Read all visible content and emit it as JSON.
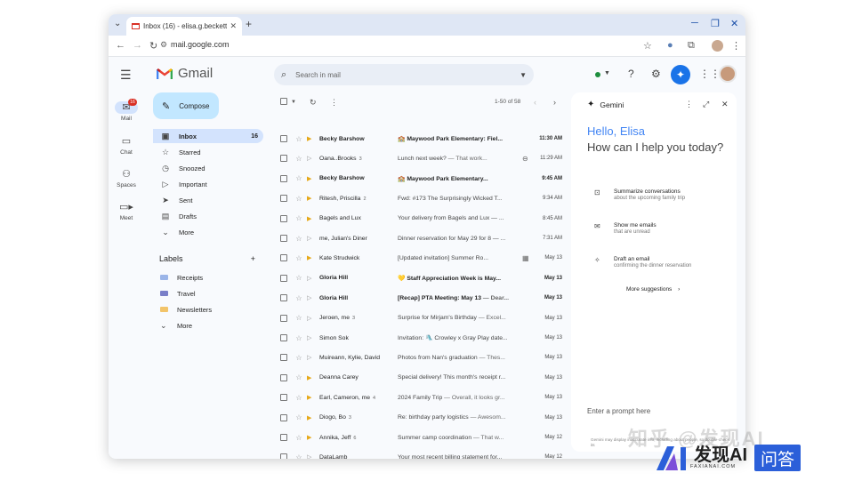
{
  "browser": {
    "tab_title": "Inbox (16) - elisa.g.beckett@",
    "url": "mail.google.com"
  },
  "gmail": {
    "product_name": "Gmail",
    "search_placeholder": "Search in mail",
    "pagination": "1-50 of 58"
  },
  "rail": {
    "items": [
      {
        "label": "Mail",
        "icon": "mail-icon",
        "badge": "16"
      },
      {
        "label": "Chat",
        "icon": "chat-icon"
      },
      {
        "label": "Spaces",
        "icon": "spaces-icon"
      },
      {
        "label": "Meet",
        "icon": "meet-icon"
      }
    ]
  },
  "sidebar": {
    "compose_label": "Compose",
    "nav": [
      {
        "label": "Inbox",
        "count": "16",
        "icon": "inbox-icon"
      },
      {
        "label": "Starred",
        "icon": "star-icon"
      },
      {
        "label": "Snoozed",
        "icon": "clock-icon"
      },
      {
        "label": "Important",
        "icon": "important-icon"
      },
      {
        "label": "Sent",
        "icon": "send-icon"
      },
      {
        "label": "Drafts",
        "icon": "draft-icon"
      },
      {
        "label": "More",
        "icon": "chevron-down-icon"
      }
    ],
    "labels_heading": "Labels",
    "labels": [
      {
        "label": "Receipts",
        "color": "#9bb5e8"
      },
      {
        "label": "Travel",
        "color": "#7a7fc8"
      },
      {
        "label": "Newsletters",
        "color": "#f2c46a"
      },
      {
        "label": "More"
      }
    ]
  },
  "emails": [
    {
      "sender": "Becky Barshow",
      "subject": "🏫 Maywood Park Elementary: Fiel...",
      "snippet": "",
      "date": "11:30 AM",
      "unread": true,
      "important": true
    },
    {
      "sender": "Oana..Brooks",
      "count": "3",
      "subject": "Lunch next week?",
      "snippet": " — That work...",
      "date": "11:29 AM",
      "unread": false,
      "important": false,
      "attachment": true
    },
    {
      "sender": "Becky Barshow",
      "subject": "🏫 Maywood Park Elementary...",
      "snippet": "",
      "date": "9:45 AM",
      "unread": true,
      "important": true
    },
    {
      "sender": "Ritesh, Priscilla",
      "count": "2",
      "subject": "Fwd: #173 The Surprisingly Wicked T...",
      "snippet": "",
      "date": "9:34 AM",
      "unread": false,
      "important": true
    },
    {
      "sender": "Bagels and Lux",
      "subject": "Your delivery from Bagels and Lux — ...",
      "snippet": "",
      "date": "8:45 AM",
      "unread": false,
      "important": true
    },
    {
      "sender": "me, Julian's Diner",
      "subject": "Dinner reservation for May 29 for 8 — ...",
      "snippet": "",
      "date": "7:31 AM",
      "unread": false,
      "important": false
    },
    {
      "sender": "Kate Strudwick",
      "subject": "[Updated invitation] Summer Ro...",
      "snippet": "",
      "date": "May 13",
      "unread": false,
      "important": true,
      "calendar": true
    },
    {
      "sender": "Gloria Hill",
      "subject": "💛 Staff Appreciation Week is May...",
      "snippet": "",
      "date": "May 13",
      "unread": true,
      "important": false
    },
    {
      "sender": "Gloria Hill",
      "subject": "[Recap] PTA Meeting: May 13",
      "snippet": " — Dear...",
      "date": "May 13",
      "unread": true,
      "important": false
    },
    {
      "sender": "Jeroen, me",
      "count": "3",
      "subject": "Surprise for Mirjam's Birthday",
      "snippet": " — Excel...",
      "date": "May 13",
      "unread": false,
      "important": false
    },
    {
      "sender": "Simon Sok",
      "subject": "Invitation: 🛝 Crowley x Gray Play date...",
      "snippet": "",
      "date": "May 13",
      "unread": false,
      "important": false
    },
    {
      "sender": "Muireann, Kylie, David",
      "subject": "Photos from Nan's graduation",
      "snippet": " — Thes...",
      "date": "May 13",
      "unread": false,
      "important": false
    },
    {
      "sender": "Deanna Carey",
      "subject": "Special delivery! This month's receipt r...",
      "snippet": "",
      "date": "May 13",
      "unread": false,
      "important": true
    },
    {
      "sender": "Earl, Cameron, me",
      "count": "4",
      "subject": "2024 Family Trip",
      "snippet": " — Overall, it looks gr...",
      "date": "May 13",
      "unread": false,
      "important": true
    },
    {
      "sender": "Diogo, Bo",
      "count": "3",
      "subject": "Re: birthday party logistics",
      "snippet": " — Awesom...",
      "date": "May 13",
      "unread": false,
      "important": true
    },
    {
      "sender": "Annika, Jeff",
      "count": "6",
      "subject": "Summer camp coordination",
      "snippet": " — That w...",
      "date": "May 12",
      "unread": false,
      "important": true
    },
    {
      "sender": "DataLamb",
      "subject": "Your most recent billing statement for...",
      "snippet": "",
      "date": "May 12",
      "unread": false,
      "important": false
    }
  ],
  "gemini": {
    "title": "Gemini",
    "greeting": "Hello, Elisa",
    "question": "How can I help you today?",
    "suggestions": [
      {
        "title": "Summarize conversations",
        "subtitle": "about the upcoming family trip"
      },
      {
        "title": "Show me emails",
        "subtitle": "that are unread"
      },
      {
        "title": "Draft an email",
        "subtitle": "confirming the dinner reservation"
      }
    ],
    "more_label": "More suggestions",
    "prompt_placeholder": "Enter a prompt here",
    "disclaimer": "Gemini may display inaccurate info, including about people, so double-check its"
  },
  "watermark": {
    "brand": "发现AI",
    "url": "FAXIANAI.COM",
    "badge": "问答"
  }
}
